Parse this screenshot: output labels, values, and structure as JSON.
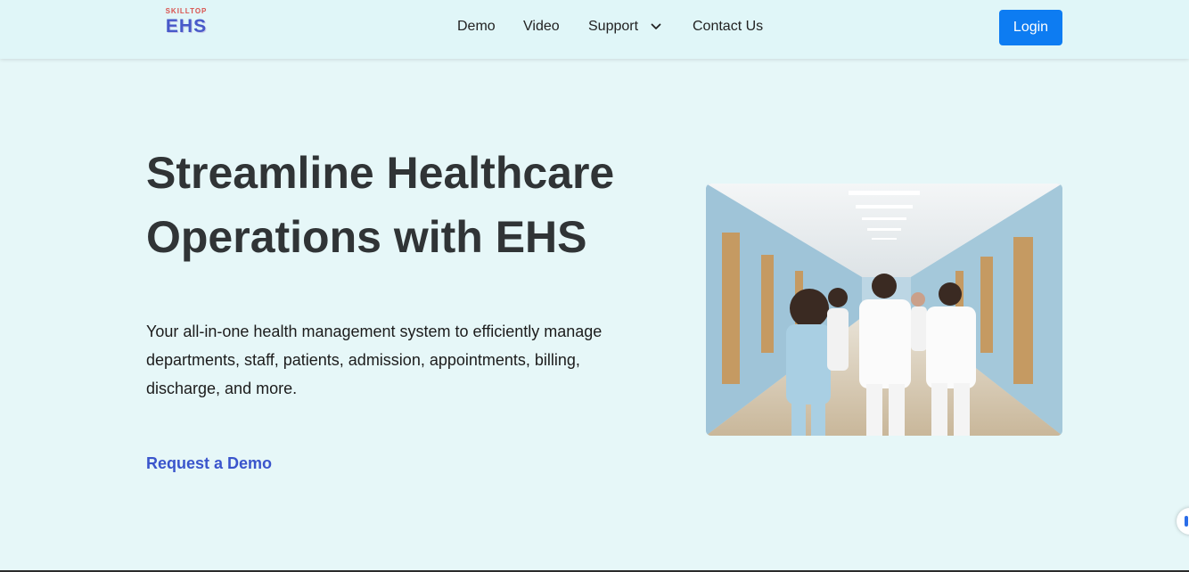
{
  "brand": {
    "tagline": "SKILLTOP",
    "name": "EHS"
  },
  "nav": {
    "items": [
      {
        "label": "Demo"
      },
      {
        "label": "Video"
      },
      {
        "label": "Support"
      },
      {
        "label": "Contact Us"
      }
    ],
    "login_label": "Login"
  },
  "hero": {
    "title_line1": "Streamline Healthcare",
    "title_line2": "Operations with EHS",
    "description": "Your all-in-one health management system to efficiently manage departments, staff, patients, admission, appointments, billing, discharge, and more.",
    "cta_label": "Request a Demo"
  },
  "colors": {
    "background": "#e6f7f8",
    "navbar": "#e0f6f8",
    "primary_button": "#0d7cf2",
    "link": "#3a55cc",
    "heading": "#303436"
  },
  "icons": {
    "support_dropdown": "chevron-down-icon"
  }
}
